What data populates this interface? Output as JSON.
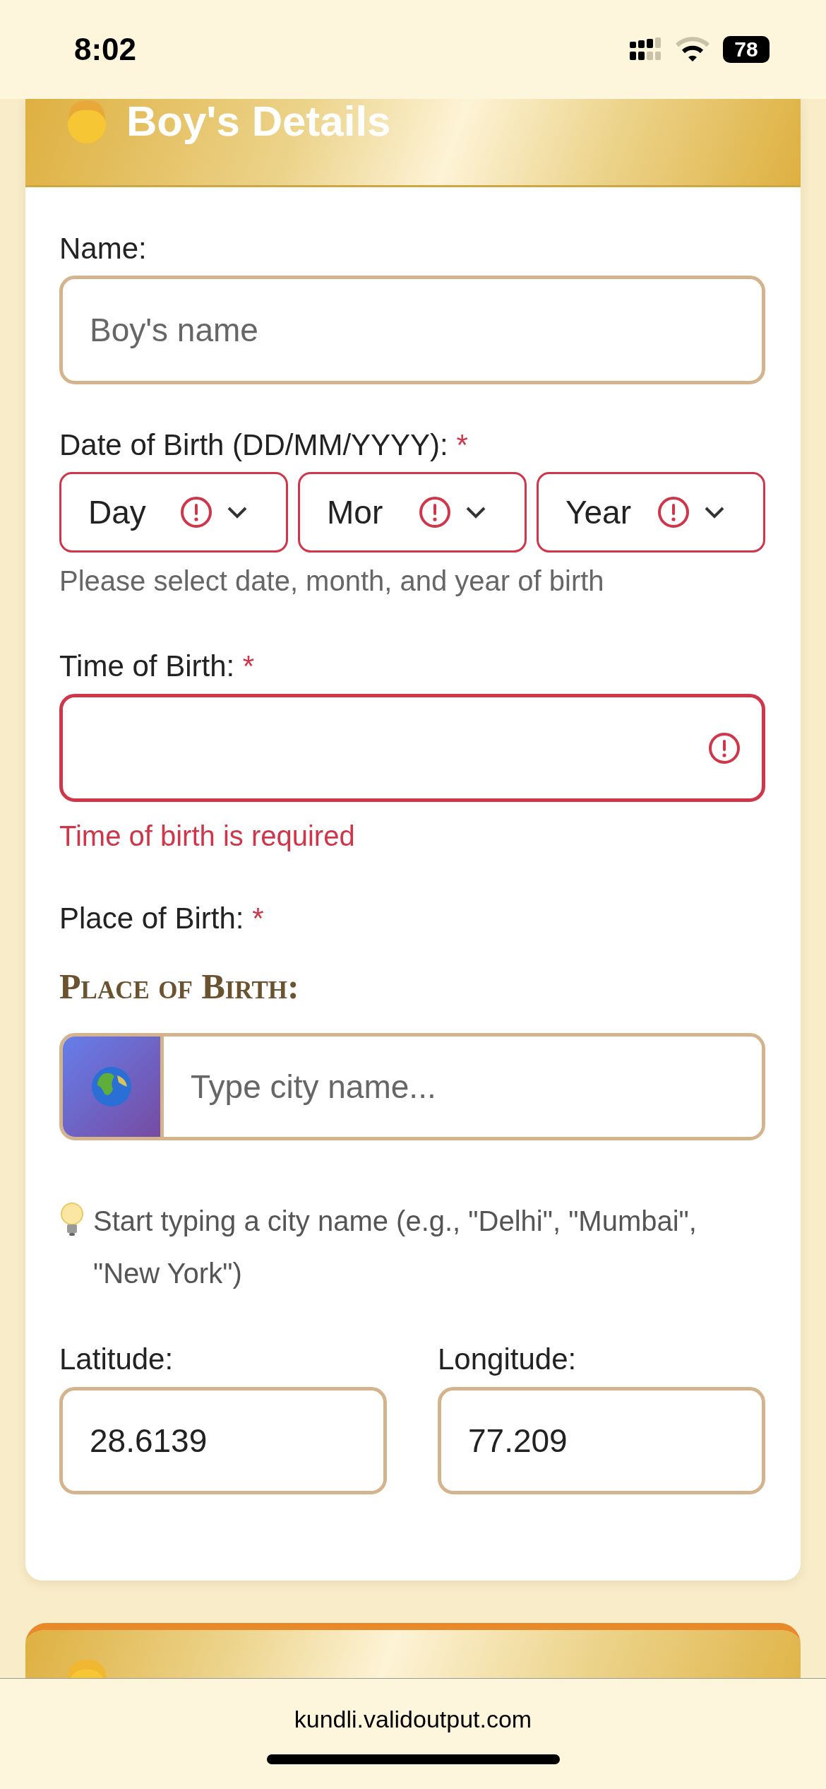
{
  "status_bar": {
    "time": "8:02",
    "battery": "78"
  },
  "boy_card": {
    "title": "Boy's Details",
    "name_field": {
      "label": "Name:",
      "placeholder": "Boy's name"
    },
    "dob": {
      "label": "Date of Birth (DD/MM/YYYY):",
      "required_mark": "*",
      "help": "Please select date, month, and year of birth",
      "selects": [
        {
          "value": "Day",
          "invalid": true
        },
        {
          "value": "Mor",
          "invalid": true
        },
        {
          "value": "Year",
          "invalid": true
        }
      ]
    },
    "time_field": {
      "label": "Time of Birth:",
      "required_mark": "*",
      "invalid": true,
      "error": "Time of birth is required"
    },
    "place": {
      "label": "Place of Birth:",
      "required_mark": "*",
      "heading": "Place of Birth:",
      "placeholder": "Type city name...",
      "hint": "Start typing a city name (e.g., \"Delhi\", \"Mumbai\", \"New York\")"
    },
    "coords": [
      {
        "label": "Latitude:",
        "value": "28.6139"
      },
      {
        "label": "Longitude:",
        "value": "77.209"
      }
    ]
  },
  "browser_bar": {
    "url": "kundli.validoutput.com"
  }
}
